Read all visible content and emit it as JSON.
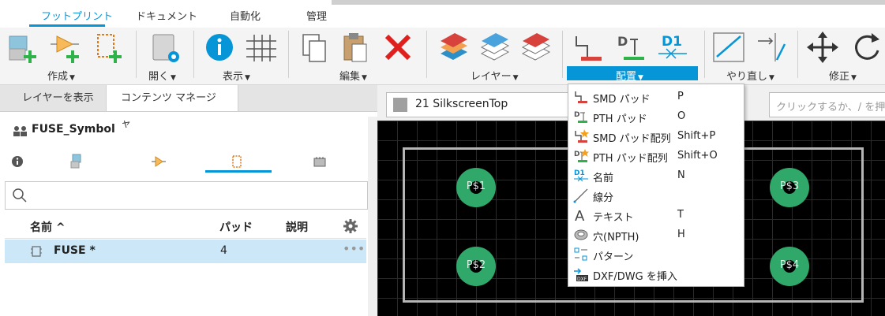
{
  "tabs": [
    {
      "label": "フットプリント",
      "active": true
    },
    {
      "label": "ドキュメント"
    },
    {
      "label": "自動化"
    },
    {
      "label": "管理"
    }
  ],
  "ribbon": {
    "create": "作成",
    "open": "開く",
    "view": "表示",
    "edit": "編集",
    "layers": "レイヤー",
    "place": "配置",
    "undo": "やり直し",
    "modify": "修正",
    "place_icon_label": "D1"
  },
  "panel": {
    "tab_show_layers": "レイヤーを表示",
    "tab_content_manager": "コンテンツ マネージャ",
    "library_title": "FUSE_Symbol",
    "columns": {
      "name": "名前 ^",
      "pads": "パッド",
      "description": "説明"
    },
    "rows": [
      {
        "name": "FUSE *",
        "pads": "4",
        "description": ""
      }
    ]
  },
  "layer": {
    "label": "21 SilkscreenTop",
    "swatch": "#a0a0a0"
  },
  "command": {
    "placeholder": "クリックするか、/ を押して"
  },
  "pads": [
    {
      "label": "P$1"
    },
    {
      "label": "P$2"
    },
    {
      "label": "P$3"
    },
    {
      "label": "P$4"
    }
  ],
  "menu": {
    "items": [
      {
        "label": "SMD パッド",
        "shortcut": "P",
        "icon": "smd-pad-icon"
      },
      {
        "label": "PTH パッド",
        "shortcut": "O",
        "icon": "pth-pad-icon"
      },
      {
        "label": "SMD パッド配列",
        "shortcut": "Shift+P",
        "icon": "smd-pad-array-icon"
      },
      {
        "label": "PTH パッド配列",
        "shortcut": "Shift+O",
        "icon": "pth-pad-array-icon"
      },
      {
        "label": "名前",
        "shortcut": "N",
        "icon": "name-icon"
      },
      {
        "label": "線分",
        "shortcut": "",
        "icon": "line-icon"
      },
      {
        "label": "テキスト",
        "shortcut": "T",
        "icon": "text-icon"
      },
      {
        "label": "穴(NPTH)",
        "shortcut": "H",
        "icon": "hole-icon"
      },
      {
        "label": "パターン",
        "shortcut": "",
        "icon": "pattern-icon"
      },
      {
        "label": "DXF/DWG を挿入",
        "shortcut": "",
        "icon": "dxf-insert-icon"
      }
    ],
    "icon_texts": {
      "name": "D1",
      "text": "A",
      "dxf": "DXF"
    }
  },
  "colors": {
    "accent": "#0696d7",
    "pad": "#2fa86a",
    "delete": "#e0201e"
  }
}
